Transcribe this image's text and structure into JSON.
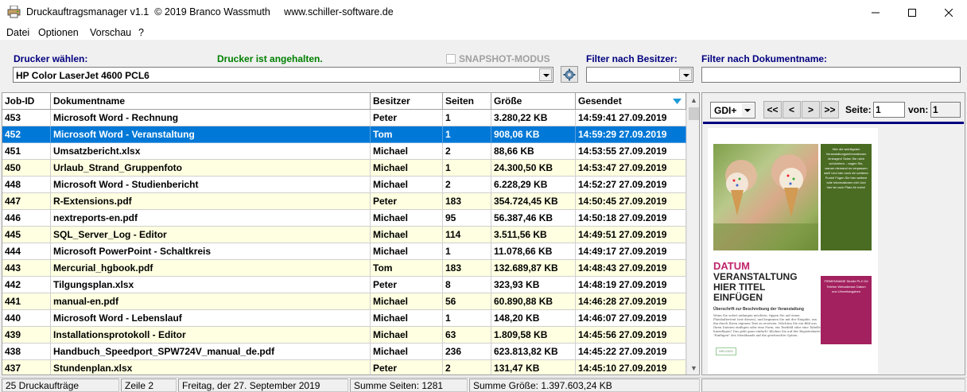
{
  "window": {
    "title": "Druckauftragsmanager v1.1  © 2019 Branco Wassmuth     www.schiller-software.de",
    "minimize_glyph": "—",
    "maximize_glyph": "☐",
    "close_glyph": "✕"
  },
  "menu": [
    {
      "label": "Datei"
    },
    {
      "label": "Optionen"
    },
    {
      "label": "Vorschau"
    },
    {
      "label": "?"
    }
  ],
  "toolbar": {
    "printer_label": "Drucker wählen:",
    "printer_status": "Drucker ist angehalten.",
    "snapshot_label": "SNAPSHOT-MODUS",
    "owner_filter_label": "Filter nach Besitzer:",
    "docname_filter_label": "Filter nach Dokumentname:",
    "printer_value": "HP Color LaserJet 4600 PCL6",
    "owner_filter_value": "",
    "docname_filter_value": ""
  },
  "table": {
    "columns": [
      "Job-ID",
      "Dokumentname",
      "Besitzer",
      "Seiten",
      "Größe",
      "Gesendet"
    ],
    "sort_indicator": "▼",
    "rows": [
      {
        "id": "453",
        "name": "Microsoft Word - Rechnung",
        "owner": "Peter",
        "pages": "1",
        "size": "3.280,22 KB",
        "sent": "14:59:41 27.09.2019"
      },
      {
        "id": "452",
        "name": "Microsoft Word - Veranstaltung",
        "owner": "Tom",
        "pages": "1",
        "size": "908,06 KB",
        "sent": "14:59:29 27.09.2019"
      },
      {
        "id": "451",
        "name": "Umsatzbericht.xlsx",
        "owner": "Michael",
        "pages": "2",
        "size": "88,66 KB",
        "sent": "14:53:55 27.09.2019"
      },
      {
        "id": "450",
        "name": "Urlaub_Strand_Gruppenfoto",
        "owner": "Michael",
        "pages": "1",
        "size": "24.300,50 KB",
        "sent": "14:53:47 27.09.2019"
      },
      {
        "id": "448",
        "name": "Microsoft Word - Studienbericht",
        "owner": "Michael",
        "pages": "2",
        "size": "6.228,29 KB",
        "sent": "14:52:27 27.09.2019"
      },
      {
        "id": "447",
        "name": "R-Extensions.pdf",
        "owner": "Peter",
        "pages": "183",
        "size": "354.724,45 KB",
        "sent": "14:50:45 27.09.2019"
      },
      {
        "id": "446",
        "name": "nextreports-en.pdf",
        "owner": "Michael",
        "pages": "95",
        "size": "56.387,46 KB",
        "sent": "14:50:18 27.09.2019"
      },
      {
        "id": "445",
        "name": "SQL_Server_Log - Editor",
        "owner": "Michael",
        "pages": "114",
        "size": "3.511,56 KB",
        "sent": "14:49:51 27.09.2019"
      },
      {
        "id": "444",
        "name": "Microsoft PowerPoint - Schaltkreis",
        "owner": "Michael",
        "pages": "1",
        "size": "11.078,66 KB",
        "sent": "14:49:17 27.09.2019"
      },
      {
        "id": "443",
        "name": "Mercurial_hgbook.pdf",
        "owner": "Tom",
        "pages": "183",
        "size": "132.689,87 KB",
        "sent": "14:48:43 27.09.2019"
      },
      {
        "id": "442",
        "name": "Tilgungsplan.xlsx",
        "owner": "Peter",
        "pages": "8",
        "size": "323,93 KB",
        "sent": "14:48:19 27.09.2019"
      },
      {
        "id": "441",
        "name": "manual-en.pdf",
        "owner": "Michael",
        "pages": "56",
        "size": "60.890,88 KB",
        "sent": "14:46:28 27.09.2019"
      },
      {
        "id": "440",
        "name": "Microsoft Word - Lebenslauf",
        "owner": "Michael",
        "pages": "1",
        "size": "148,20 KB",
        "sent": "14:46:07 27.09.2019"
      },
      {
        "id": "439",
        "name": "Installationsprotokoll - Editor",
        "owner": "Michael",
        "pages": "63",
        "size": "1.809,58 KB",
        "sent": "14:45:56 27.09.2019"
      },
      {
        "id": "438",
        "name": "Handbuch_Speedport_SPW724V_manual_de.pdf",
        "owner": "Michael",
        "pages": "236",
        "size": "623.813,82 KB",
        "sent": "14:45:22 27.09.2019"
      },
      {
        "id": "437",
        "name": "Stundenplan.xlsx",
        "owner": "Peter",
        "pages": "2",
        "size": "131,47 KB",
        "sent": "14:45:10 27.09.2019"
      }
    ]
  },
  "preview": {
    "renderer": "GDI+",
    "nav": [
      "<<",
      "<",
      ">",
      ">>"
    ],
    "page_label": "Seite:",
    "page_value": "1",
    "of_label": "von:",
    "of_value": "1",
    "doc": {
      "green_box": "Hier die wichtigsten Veranstaltungsinformationen eintragen! Seien Sie nicht schüchtern – sagen Sie, warum niemand es verpassen darf! Und hier noch ein weiterer Punkt! Fügen Sie hier weitere tolle Informationen ein! Und hier ist noch Platz für mehr!",
      "datum": "DATUM",
      "title": "VERANSTALTUNG HIER TITEL EINFÜGEN",
      "subtitle": "Überschrift zur Beschreibung der Veranstaltung",
      "body": "Wenn Sie sofort anfangen möchten, tippen Sie auf einen Platzhaltertext (wie diesen), und beginnen Sie mit der Eingabe, um ihn durch Ihren eigenen Text zu ersetzen. Möchten Sie ein Bild aus Ihren Dateien einfügen oder eine Form, ein Textfeld oder eine Tabelle hinzufügen? Das geht ganz einfach! Klicken Sie auf der Registerkarte \"Einfügen\" des Menübands auf die gewünschte Option.",
      "magenta_box": "FIRMENNAME Straße PLZ Ort Telefon Webadresse Datum und Uhrzeitangaben",
      "logo": "IHR LOGO"
    }
  },
  "status": {
    "count": "25 Druckaufträge",
    "line": "Zeile 2",
    "date": "Freitag, der 27. September 2019",
    "sum_pages": "Summe Seiten: 1281",
    "sum_size": "Summe Größe: 1.397.603,24 KB"
  },
  "colors": {
    "selection": "#0078d7",
    "even_row": "#ffffe1",
    "label_blue": "#000080",
    "status_green": "#008000"
  }
}
